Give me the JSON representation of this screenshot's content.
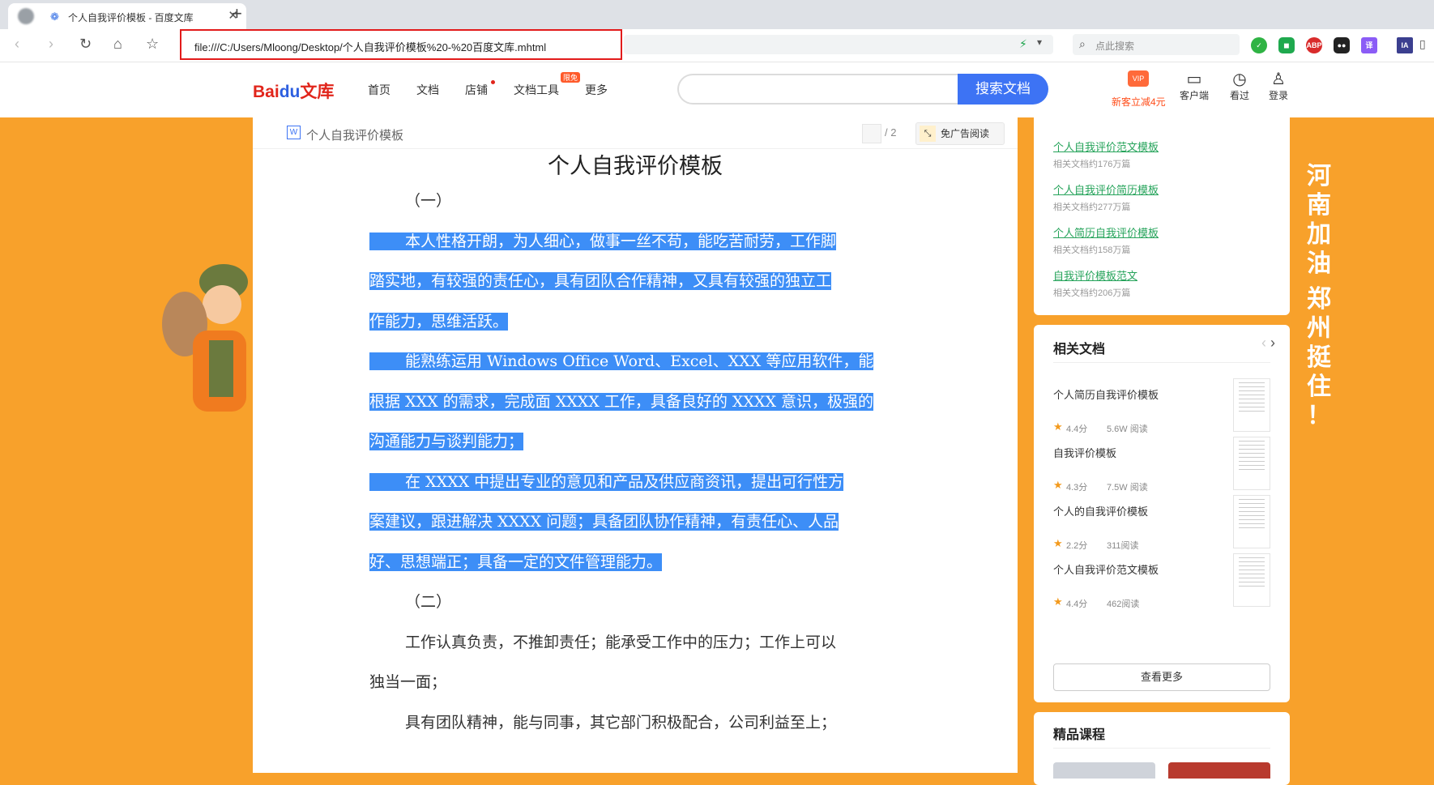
{
  "browser": {
    "tab_title": "个人自我评价模板 - 百度文库",
    "tab_close": "✕",
    "new_tab": "+",
    "url": "file:///C:/Users/Mloong/Desktop/个人自我评价模板%20-%20百度文库.mhtml",
    "search_placeholder": "点此搜索",
    "extensions": [
      "ABP",
      "译",
      "IA"
    ]
  },
  "site": {
    "logo_text": "Bai",
    "logo_paw": "du",
    "logo_wenku": "文库",
    "nav": [
      "首页",
      "文档",
      "店铺",
      "文档工具",
      "更多"
    ],
    "tool_badge": "限免",
    "search_button": "搜索文档",
    "vip_badge": "VIP",
    "promo": "新客立减4元",
    "client": "客户端",
    "history": "看过",
    "login": "登录"
  },
  "doc": {
    "header_title": "个人自我评价模板",
    "page_total": "/ 2",
    "ad_button": "免广告阅读",
    "title": "个人自我评价模板",
    "lines": [
      {
        "text": "（一）",
        "indent": true,
        "hl": false
      },
      {
        "text": "本人性格开朗，为人细心，做事一丝不苟，能吃苦耐劳，工作脚",
        "indent": true,
        "hl": true
      },
      {
        "text": "踏实地，有较强的责任心，具有团队合作精神，又具有较强的独立工",
        "indent": false,
        "hl": true
      },
      {
        "text": "作能力，思维活跃。 ",
        "indent": false,
        "hl": true
      },
      {
        "text": "能熟练运用 Windows Office Word、Excel、XXX 等应用软件，能",
        "indent": true,
        "hl": true
      },
      {
        "text": "根据 XXX 的需求，完成面 XXXX 工作，具备良好的 XXXX 意识，极强的",
        "indent": false,
        "hl": true
      },
      {
        "text": "沟通能力与谈判能力； ",
        "indent": false,
        "hl": true
      },
      {
        "text": "在 XXXX 中提出专业的意见和产品及供应商资讯，提出可行性方",
        "indent": true,
        "hl": true
      },
      {
        "text": "案建议，跟进解决 XXXX 问题；具备团队协作精神，有责任心、人品",
        "indent": false,
        "hl": true
      },
      {
        "text": "好、思想端正；具备一定的文件管理能力。",
        "indent": false,
        "hl": true
      },
      {
        "text": "（二）",
        "indent": true,
        "hl": false
      },
      {
        "text": "工作认真负责，不推卸责任；能承受工作中的压力；工作上可以",
        "indent": true,
        "hl": false
      },
      {
        "text": "独当一面；",
        "indent": false,
        "hl": false
      },
      {
        "text": "具有团队精神，能与同事，其它部门积极配合，公司利益至上；",
        "indent": true,
        "hl": false
      }
    ]
  },
  "sidebar": {
    "related_searches": [
      {
        "title": "个人自我评价范文模板",
        "count": "相关文档约176万篇"
      },
      {
        "title": "个人自我评价简历模板",
        "count": "相关文档约277万篇"
      },
      {
        "title": "个人简历自我评价模板",
        "count": "相关文档约158万篇"
      },
      {
        "title": "自我评价模板范文",
        "count": "相关文档约206万篇"
      }
    ],
    "related_title": "相关文档",
    "related_docs": [
      {
        "name": "个人简历自我评价模板",
        "score": "4.4分",
        "reads": "5.6W 阅读"
      },
      {
        "name": "自我评价模板",
        "score": "4.3分",
        "reads": "7.5W 阅读"
      },
      {
        "name": "个人的自我评价模板",
        "score": "2.2分",
        "reads": "311阅读"
      },
      {
        "name": "个人自我评价范文模板",
        "score": "4.4分",
        "reads": "462阅读"
      }
    ],
    "more_button": "查看更多",
    "courses_title": "精品课程"
  },
  "slogan": [
    "河",
    "南",
    "加",
    "油",
    "郑",
    "州",
    "挺",
    "住",
    "！"
  ]
}
